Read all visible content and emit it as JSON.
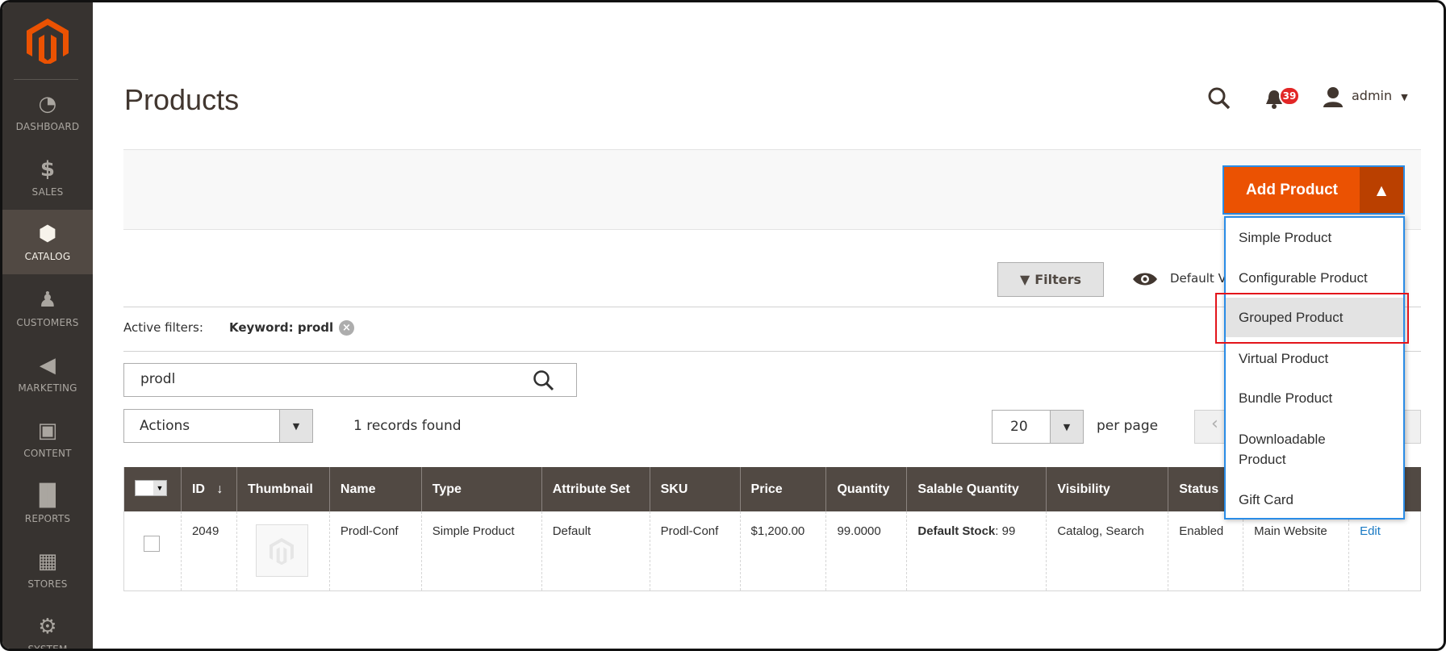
{
  "sidebar": {
    "items": [
      {
        "label": "DASHBOARD",
        "icon": "dashboard-gauge-icon"
      },
      {
        "label": "SALES",
        "icon": "dollar-icon"
      },
      {
        "label": "CATALOG",
        "icon": "box-icon",
        "active": true
      },
      {
        "label": "CUSTOMERS",
        "icon": "person-icon"
      },
      {
        "label": "MARKETING",
        "icon": "megaphone-icon"
      },
      {
        "label": "CONTENT",
        "icon": "layout-icon"
      },
      {
        "label": "REPORTS",
        "icon": "bar-chart-icon"
      },
      {
        "label": "STORES",
        "icon": "storefront-icon"
      },
      {
        "label": "SYSTEM",
        "icon": "gear-icon"
      }
    ]
  },
  "header": {
    "title": "Products",
    "notifications": "39",
    "user": "admin"
  },
  "colors": {
    "accent": "#eb5202",
    "sidebar": "#373330",
    "table_header": "#514943",
    "link": "#1979c3",
    "highlight_box": "#e3141b"
  },
  "add_product": {
    "label": "Add Product",
    "menu": [
      "Simple Product",
      "Configurable Product",
      "Grouped Product",
      "Virtual Product",
      "Bundle Product",
      "Downloadable",
      "Product",
      "Gift Card"
    ],
    "highlighted": "Grouped Product"
  },
  "toolbar": {
    "filters": "Filters",
    "default_view": "Default V"
  },
  "active_filters": {
    "label": "Active filters:",
    "keyword": "Keyword: prodl"
  },
  "search": {
    "value": "prodl"
  },
  "actions": {
    "label": "Actions"
  },
  "records": "1 records found",
  "per_page": {
    "value": "20",
    "label": "per page"
  },
  "table": {
    "headers": [
      "ID",
      "Thumbnail",
      "Name",
      "Type",
      "Attribute Set",
      "SKU",
      "Price",
      "Quantity",
      "Salable Quantity",
      "Visibility",
      "Status"
    ],
    "row": {
      "id": "2049",
      "name": "Prodl-Conf",
      "type": "Simple Product",
      "attribute_set": "Default",
      "sku": "Prodl-Conf",
      "price": "$1,200.00",
      "quantity": "99.0000",
      "salable_bold": "Default Stock",
      "salable_rest": ": 99",
      "visibility": "Catalog, Search",
      "status": "Enabled",
      "website": "Main Website",
      "action": "Edit"
    }
  }
}
